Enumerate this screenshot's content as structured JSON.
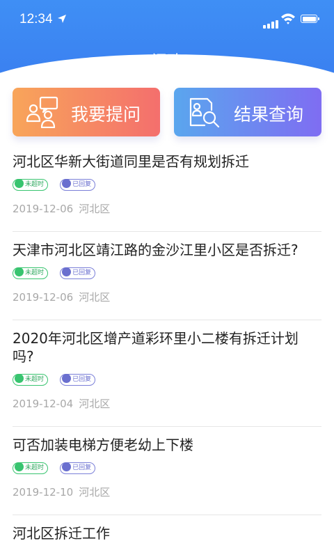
{
  "status_bar": {
    "time": "12:34"
  },
  "header": {
    "title": "问政"
  },
  "actions": {
    "ask_label": "我要提问",
    "query_label": "结果查询"
  },
  "items": [
    {
      "question": "河北区华新大街道同里是否有规划拆迁",
      "tag_time": "未超时",
      "tag_reply": "已回复",
      "date": "2019-12-06",
      "district": "河北区"
    },
    {
      "question": "天津市河北区靖江路的金沙江里小区是否拆迁?",
      "tag_time": "未超时",
      "tag_reply": "已回复",
      "date": "2019-12-06",
      "district": "河北区"
    },
    {
      "question": "2020年河北区增产道彩环里小二楼有拆迁计划吗?",
      "tag_time": "未超时",
      "tag_reply": "已回复",
      "date": "2019-12-04",
      "district": "河北区"
    },
    {
      "question": "可否加装电梯方便老幼上下楼",
      "tag_time": "未超时",
      "tag_reply": "已回复",
      "date": "2019-12-10",
      "district": "河北区"
    },
    {
      "question": "河北区拆迁工作",
      "tag_time": "",
      "tag_reply": "",
      "date": "",
      "district": ""
    }
  ]
}
